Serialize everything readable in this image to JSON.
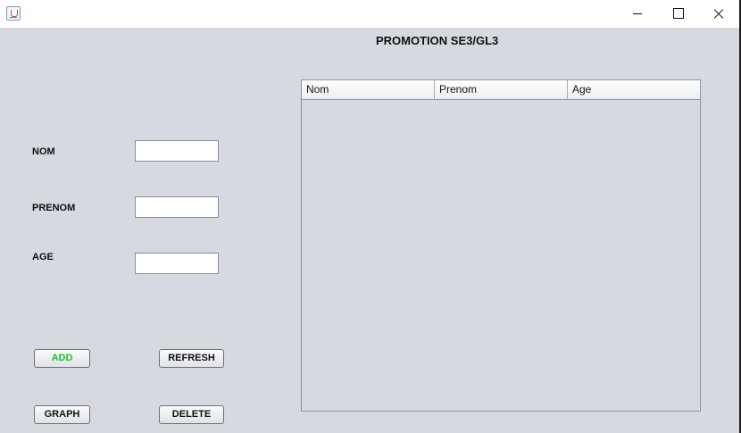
{
  "window": {
    "controls": {
      "minimize_icon": "minimize-icon",
      "maximize_icon": "maximize-icon",
      "close_icon": "close-icon"
    }
  },
  "header": {
    "title": "PROMOTION SE3/GL3"
  },
  "form": {
    "nom_label": "NOM",
    "prenom_label": "PRENOM",
    "age_label": "AGE",
    "nom_value": "",
    "prenom_value": "",
    "age_value": ""
  },
  "buttons": {
    "add": "ADD",
    "refresh": "REFRESH",
    "graph": "GRAPH",
    "delete": "DELETE"
  },
  "table": {
    "columns": [
      "Nom",
      "Prenom",
      "Age"
    ],
    "rows": []
  },
  "colors": {
    "window_bg": "#d6d9df",
    "add_text": "#22c22a"
  }
}
